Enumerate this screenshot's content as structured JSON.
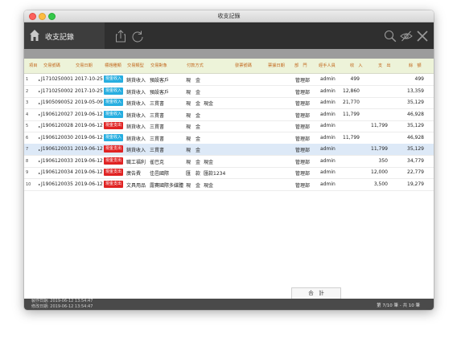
{
  "window": {
    "title": "收支記錄"
  },
  "toolbar": {
    "title": "收支記錄",
    "icons": [
      "home-icon",
      "share-icon",
      "refresh-icon",
      "search-icon",
      "hide-icon",
      "close-icon"
    ]
  },
  "table": {
    "headers": {
      "index": "項目",
      "serial": "交易號碼",
      "date": "交易日期",
      "category": "標題種類",
      "type": "交易類型",
      "target": "交易對象",
      "payment": "付款方式",
      "invoice": "發票號碼",
      "invoice_date": "票據日期",
      "dept": "部　門",
      "handler": "經手人員",
      "income": "收　入",
      "expense": "支　出",
      "balance": "餘　額"
    },
    "rows": [
      {
        "index": "1",
        "serial": "J1710250001",
        "date": "2017-10-25",
        "badge": "現金收入",
        "badge_kind": "income",
        "type": "銷貨收入",
        "target": "預設客戶",
        "payment": "現　金",
        "payment_note": "",
        "dept": "管理部",
        "handler": "admin",
        "income": "499",
        "expense": "",
        "balance": "499"
      },
      {
        "index": "2",
        "serial": "J1710250002",
        "date": "2017-10-25",
        "badge": "現金收入",
        "badge_kind": "income",
        "type": "銷貨收入",
        "target": "預設客戶",
        "payment": "現　金",
        "payment_note": "",
        "dept": "管理部",
        "handler": "admin",
        "income": "12,860",
        "expense": "",
        "balance": "13,359"
      },
      {
        "index": "3",
        "serial": "J1905090052",
        "date": "2019-05-09",
        "badge": "現金收入",
        "badge_kind": "income",
        "type": "銷貨收入",
        "target": "三貫書",
        "payment": "現　金",
        "payment_note": "現金",
        "dept": "管理部",
        "handler": "admin",
        "income": "21,770",
        "expense": "",
        "balance": "35,129"
      },
      {
        "index": "4",
        "serial": "J1906120027",
        "date": "2019-06-12",
        "badge": "現金收入",
        "badge_kind": "income",
        "type": "銷貨收入",
        "target": "三貫書",
        "payment": "現　金",
        "payment_note": "",
        "dept": "管理部",
        "handler": "admin",
        "income": "11,799",
        "expense": "",
        "balance": "46,928"
      },
      {
        "index": "5",
        "serial": "J1906120028",
        "date": "2019-06-12",
        "badge": "現金支出",
        "badge_kind": "expense",
        "type": "銷貨收入",
        "target": "三貫書",
        "payment": "現　金",
        "payment_note": "",
        "dept": "管理部",
        "handler": "admin",
        "income": "",
        "expense": "11,799",
        "balance": "35,129"
      },
      {
        "index": "6",
        "serial": "J1906120030",
        "date": "2019-06-12",
        "badge": "現金收入",
        "badge_kind": "income",
        "type": "銷貨收入",
        "target": "三貫書",
        "payment": "現　金",
        "payment_note": "",
        "dept": "管理部",
        "handler": "admin",
        "income": "11,799",
        "expense": "",
        "balance": "46,928"
      },
      {
        "index": "7",
        "serial": "J1906120031",
        "date": "2019-06-12",
        "badge": "現金支出",
        "badge_kind": "expense",
        "type": "銷貨收入",
        "target": "三貫書",
        "payment": "現　金",
        "payment_note": "",
        "dept": "管理部",
        "handler": "admin",
        "income": "",
        "expense": "11,799",
        "balance": "35,129"
      },
      {
        "index": "8",
        "serial": "J1906120033",
        "date": "2019-06-12",
        "badge": "現金支出",
        "badge_kind": "expense",
        "type": "職工福利",
        "target": "雀巴克",
        "payment": "現　金",
        "payment_note": "現金",
        "dept": "管理部",
        "handler": "admin",
        "income": "",
        "expense": "350",
        "balance": "34,779"
      },
      {
        "index": "9",
        "serial": "J1906120034",
        "date": "2019-06-12",
        "badge": "現金支出",
        "badge_kind": "expense",
        "type": "廣告費",
        "target": "佳邑國際",
        "payment": "匯　款",
        "payment_note": "匯款1234",
        "dept": "管理部",
        "handler": "admin",
        "income": "",
        "expense": "12,000",
        "balance": "22,779"
      },
      {
        "index": "10",
        "serial": "J1906120035",
        "date": "2019-06-12",
        "badge": "現金支出",
        "badge_kind": "expense",
        "type": "文具用品",
        "target": "露賽國際多媒體",
        "payment": "現　金",
        "payment_note": "現金",
        "dept": "管理部",
        "handler": "admin",
        "income": "",
        "expense": "3,500",
        "balance": "19,279"
      }
    ],
    "selected_index": 6
  },
  "footer": {
    "total_label": "合　計",
    "created": "製作日期: 2019-06-12  13:54:47",
    "modified": "修改日期: 2019-06-12  13:54:47",
    "pagination": "第 7/10 筆 - 共 10 筆"
  }
}
